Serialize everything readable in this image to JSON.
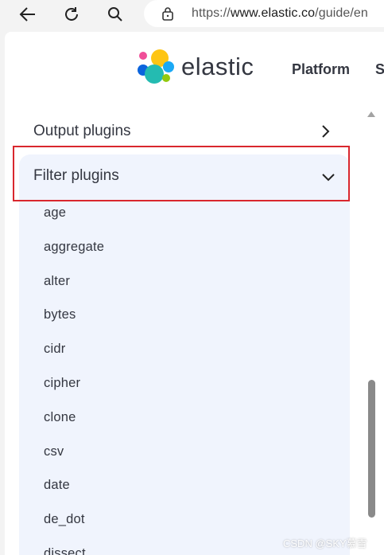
{
  "browser": {
    "url_prefix": "https://",
    "url_domain": "www.elastic.co",
    "url_path": "/guide/en"
  },
  "header": {
    "logo_text": "elastic",
    "nav_platform": "Platform",
    "nav_next_partial": "S"
  },
  "sidebar": {
    "output_plugins_label": "Output plugins",
    "filter_plugins_label": "Filter plugins",
    "filter_items": [
      "age",
      "aggregate",
      "alter",
      "bytes",
      "cidr",
      "cipher",
      "clone",
      "csv",
      "date",
      "de_dot",
      "dissect"
    ]
  },
  "watermark": "CSDN @SKY慕雪",
  "colors": {
    "highlight": "#d9272e",
    "panel_bg": "#f0f4fd",
    "text": "#343741"
  }
}
